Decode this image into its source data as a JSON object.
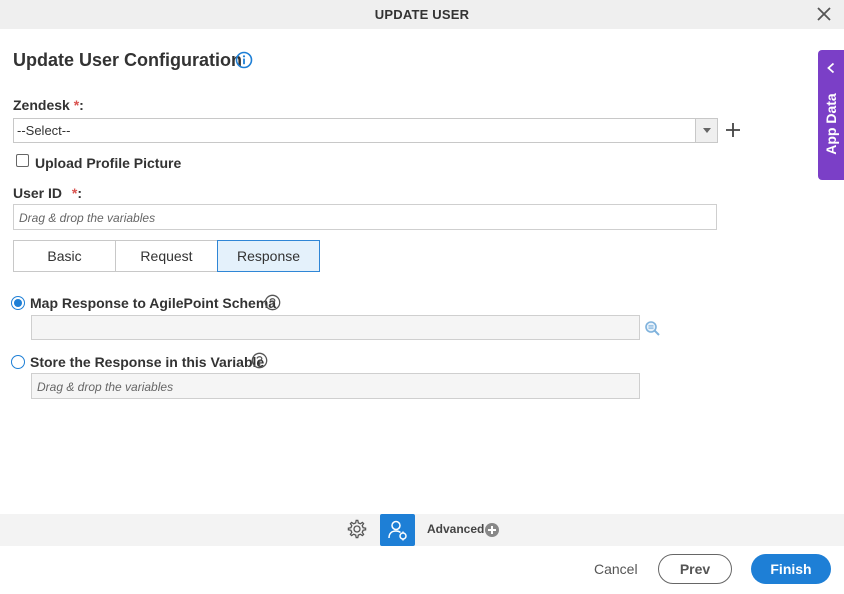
{
  "dialog": {
    "title": "UPDATE USER"
  },
  "config": {
    "title": "Update User Configuration"
  },
  "zendesk": {
    "label": "Zendesk",
    "required_mark": "*",
    "colon": ":",
    "selected": "--Select--"
  },
  "upload_profile": {
    "label": "Upload Profile Picture",
    "checked": false
  },
  "user_id": {
    "label": "User ID",
    "required_mark": "*",
    "colon": ":",
    "placeholder": "Drag & drop the variables"
  },
  "tabs": [
    {
      "label": "Basic",
      "active": false
    },
    {
      "label": "Request",
      "active": false
    },
    {
      "label": "Response",
      "active": true
    }
  ],
  "response": {
    "map_option": {
      "label": "Map Response to AgilePoint Schema",
      "selected": true
    },
    "map_value": "",
    "store_option": {
      "label": "Store the Response in this Variable",
      "selected": false
    },
    "store_placeholder": "Drag & drop the variables"
  },
  "side_panel": {
    "label": "App Data"
  },
  "toolbar": {
    "advanced_label": "Advanced"
  },
  "footer": {
    "cancel_label": "Cancel",
    "prev_label": "Prev",
    "finish_label": "Finish"
  },
  "colors": {
    "accent": "#1e7fd6",
    "side_panel": "#7b3fc7",
    "required": "#d9534f"
  },
  "icons": {
    "close": "close-icon",
    "info": "info-icon",
    "add": "plus-icon",
    "dropdown": "chevron-down-icon",
    "help": "question-circle-icon",
    "lookup": "search-icon",
    "settings": "gear-icon",
    "user": "user-settings-icon",
    "expand": "chevron-left-icon",
    "advanced": "plus-circle-icon"
  }
}
